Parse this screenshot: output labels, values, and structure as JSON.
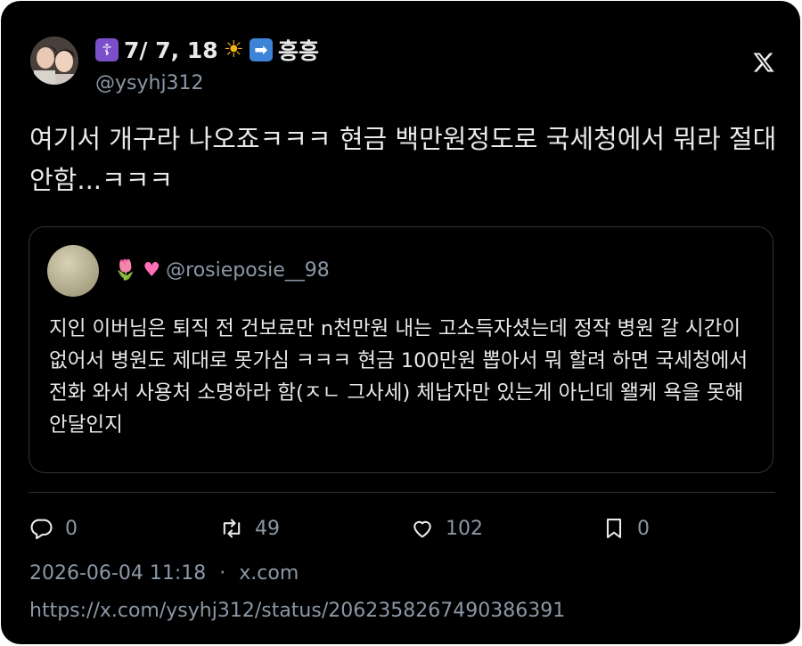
{
  "author": {
    "display_name_text": "7/ 7, 18",
    "display_name_suffix": "흥흥",
    "name_icons": [
      "orthodox-cross-icon",
      "sun-icon",
      "right-arrow-icon"
    ],
    "handle": "@ysyhj312"
  },
  "tweet": {
    "text": "여기서 개구라 나오죠ㅋㅋㅋ 현금 백만원정도로 국세청에서 뭐라 절대 안함...ㅋㅋㅋ"
  },
  "quote": {
    "handle": "@rosieposie__98",
    "name_icons": [
      "tulip-icon",
      "pink-heart-icon"
    ],
    "text": "지인 이버님은 퇴직 전 건보료만 n천만원 내는 고소득자셨는데 정작 병원 갈 시간이 없어서 병원도 제대로 못가심 ㅋㅋㅋ 현금 100만원 뽑아서 뭐 할려 하면 국세청에서 전화 와서 사용처 소명하라 함(ㅈㄴ 그사세) 체납자만 있는게 아닌데 왤케 욕을 못해 안달인지"
  },
  "actions": {
    "replies": "0",
    "retweets": "49",
    "likes": "102",
    "bookmarks": "0"
  },
  "meta": {
    "timestamp": "2026-06-04 11:18",
    "separator": "·",
    "source": "x.com",
    "url": "https://x.com/ysyhj312/status/2062358267490386391"
  },
  "colors": {
    "background": "#000000",
    "text": "#e7e9ea",
    "muted": "#8b98a5",
    "border": "#2f3336"
  }
}
